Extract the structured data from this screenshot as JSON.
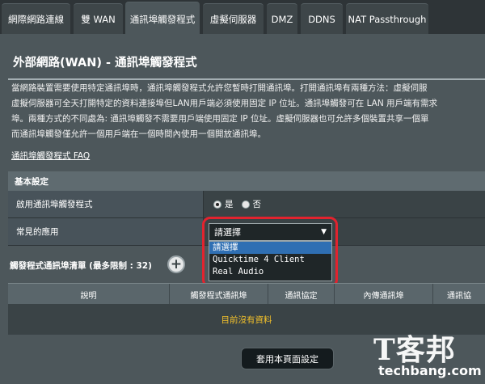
{
  "tabs": [
    {
      "label": "網際網路連線",
      "active": false
    },
    {
      "label": "雙 WAN",
      "active": false
    },
    {
      "label": "通訊埠觸發程式",
      "active": true
    },
    {
      "label": "虛擬伺服器",
      "active": false
    },
    {
      "label": "DMZ",
      "active": false
    },
    {
      "label": "DDNS",
      "active": false
    },
    {
      "label": "NAT Passthrough",
      "active": false
    }
  ],
  "page": {
    "title": "外部網路(WAN) - 通訊埠觸發程式",
    "description_lines": [
      "當網路裝置需要使用特定通訊埠時，通訊埠觸發程式允許您暫時打開通訊埠。打開通訊埠有兩種方法：虛擬伺服",
      "虛擬伺服器可全天打開特定的資料連接埠但LAN用戶端必須使用固定 IP 位址。通訊埠觸發可在 LAN 用戶端有需求",
      "埠。兩種方式的不同處為: 通訊埠觸發不需要用戶端使用固定 IP 位址。虛擬伺服器也可允許多個裝置共享一個單",
      "而通訊埠觸發僅允許一個用戶端在一個時間內使用一個開放通訊埠。"
    ],
    "faq_link": "通訊埠觸發程式 FAQ"
  },
  "basic_settings": {
    "header": "基本設定",
    "enable_label": "啟用通訊埠觸發程式",
    "radio_yes": "是",
    "radio_no": "否",
    "selected": "yes",
    "common_app_label": "常見的應用",
    "select_value": "請選擇",
    "select_arrow": "▼",
    "options": [
      "請選擇",
      "Quicktime 4 Client",
      "Real Audio"
    ]
  },
  "trigger_list": {
    "title": "觸發程式通訊埠清單 (最多限制 : 32)",
    "add_icon": "plus-circle-icon",
    "add_glyph": "+",
    "columns": [
      "說明",
      "觸發程式通訊埠",
      "通訊協定",
      "內傳通訊埠",
      "通訊協"
    ],
    "empty_message": "目前沒有資料"
  },
  "apply_button": "套用本頁面設定",
  "watermark": {
    "mark": "T客邦",
    "site": "techbang.com"
  },
  "colors": {
    "background": "#2e3437",
    "panel": "#4d575b",
    "highlight": "#e2232e",
    "empty_text": "#f3c12b",
    "selected_option": "#2f6fb3"
  }
}
